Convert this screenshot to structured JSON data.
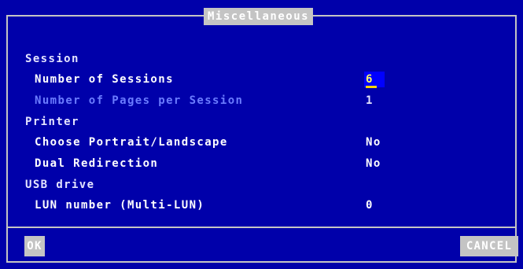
{
  "dialog": {
    "title": "Miscellaneous"
  },
  "sections": {
    "session": {
      "label": "Session",
      "number_of_sessions": {
        "label": "Number of Sessions",
        "value": "6"
      },
      "pages_per_session": {
        "label": "Number of Pages per Session",
        "value": "1"
      }
    },
    "printer": {
      "label": "Printer",
      "portrait_landscape": {
        "label": "Choose Portrait/Landscape",
        "value": "No"
      },
      "dual_redirection": {
        "label": "Dual Redirection",
        "value": "No"
      }
    },
    "usb": {
      "label": "USB drive",
      "lun_number": {
        "label": "LUN number (Multi-LUN)",
        "value": "0"
      }
    }
  },
  "buttons": {
    "ok": "OK",
    "cancel": "CANCEL"
  },
  "colors": {
    "background": "#0000aa",
    "frame": "#c4c4c4",
    "focus_field": "#0000ff",
    "focus_text": "#ffff66",
    "disabled_text": "#6b7cff"
  }
}
